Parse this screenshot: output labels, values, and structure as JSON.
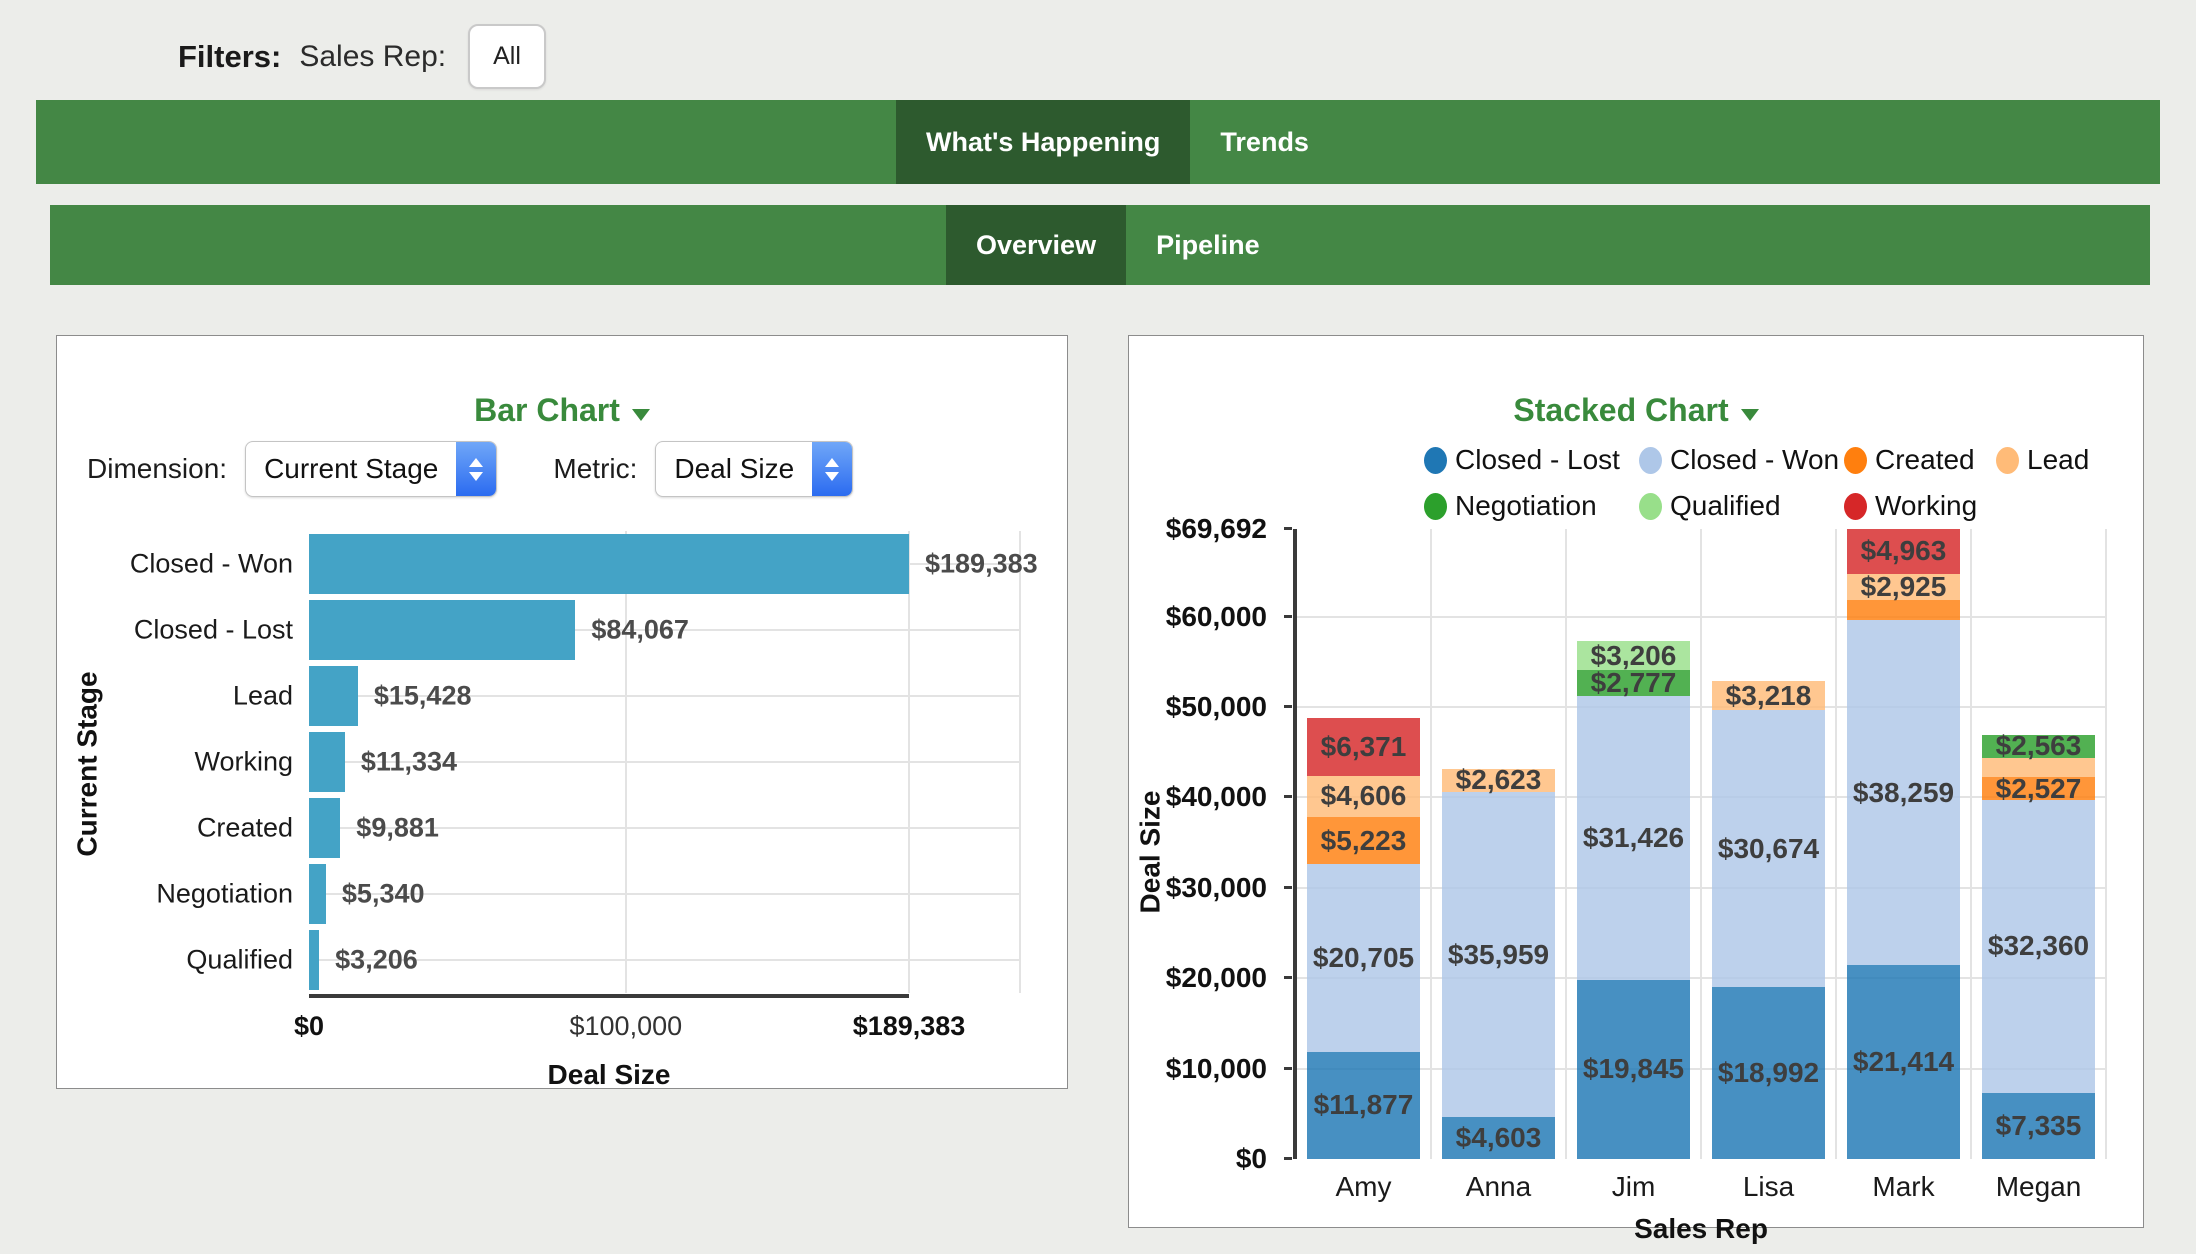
{
  "filters": {
    "label": "Filters:",
    "field_label": "Sales Rep:",
    "value": "All"
  },
  "nav_primary": {
    "tabs": [
      {
        "label": "What's Happening",
        "active": true
      },
      {
        "label": "Trends",
        "active": false
      }
    ]
  },
  "nav_secondary": {
    "tabs": [
      {
        "label": "Overview",
        "active": true
      },
      {
        "label": "Pipeline",
        "active": false
      }
    ]
  },
  "colors": {
    "nav_bar": "#448745",
    "nav_active": "#2d5a2e",
    "panel_title": "#398a3c",
    "left_bar": "#44a3c6",
    "grid": "#e3e3e3",
    "axis": "#3a3a3a",
    "page_bg": "#ecedea"
  },
  "left_panel": {
    "title": "Bar Chart",
    "dimension_label": "Dimension:",
    "dimension_value": "Current Stage",
    "metric_label": "Metric:",
    "metric_value": "Deal Size",
    "chart_data": {
      "type": "bar",
      "orientation": "horizontal",
      "categories": [
        "Closed - Won",
        "Closed - Lost",
        "Lead",
        "Working",
        "Created",
        "Negotiation",
        "Qualified"
      ],
      "values": [
        189383,
        84067,
        15428,
        11334,
        9881,
        5340,
        3206
      ],
      "value_labels": [
        "$189,383",
        "$84,067",
        "$15,428",
        "$11,334",
        "$9,881",
        "$5,340",
        "$3,206"
      ],
      "xlabel": "Deal Size",
      "ylabel": "Current Stage",
      "xlim": [
        0,
        189383
      ],
      "xticks": [
        {
          "label": "$0",
          "value": 0,
          "bold": true
        },
        {
          "label": "$100,000",
          "value": 100000,
          "bold": false
        },
        {
          "label": "$189,383",
          "value": 189383,
          "bold": true
        }
      ],
      "bar_color": "#44a3c6",
      "grid": true
    }
  },
  "right_panel": {
    "title": "Stacked Chart",
    "chart_data": {
      "type": "bar",
      "stacked": true,
      "categories": [
        "Amy",
        "Anna",
        "Jim",
        "Lisa",
        "Mark",
        "Megan"
      ],
      "series": [
        {
          "name": "Closed - Lost",
          "color": "#1f77b4",
          "values": [
            11877,
            4603,
            19845,
            18992,
            21414,
            7335
          ],
          "labels": [
            "$11,877",
            "$4,603",
            "$19,845",
            "$18,992",
            "$21,414",
            "$7,335"
          ]
        },
        {
          "name": "Closed - Won",
          "color": "#aec7e8",
          "values": [
            20705,
            35959,
            31426,
            30674,
            38259,
            32360
          ],
          "labels": [
            "$20,705",
            "$35,959",
            "$31,426",
            "$30,674",
            "$38,259",
            "$32,360"
          ]
        },
        {
          "name": "Created",
          "color": "#ff7f0e",
          "values": [
            5223,
            0,
            0,
            0,
            2131,
            2527
          ],
          "labels": [
            "$5,223",
            null,
            null,
            null,
            null,
            "$2,527"
          ]
        },
        {
          "name": "Lead",
          "color": "#ffbb78",
          "values": [
            4606,
            2623,
            0,
            3218,
            2925,
            2173
          ],
          "labels": [
            "$4,606",
            "$2,623",
            null,
            "$3,218",
            "$2,925",
            null
          ]
        },
        {
          "name": "Negotiation",
          "color": "#2ca02c",
          "values": [
            0,
            0,
            2777,
            0,
            0,
            2563
          ],
          "labels": [
            null,
            null,
            "$2,777",
            null,
            null,
            "$2,563"
          ]
        },
        {
          "name": "Qualified",
          "color": "#98df8a",
          "values": [
            0,
            0,
            3206,
            0,
            0,
            0
          ],
          "labels": [
            null,
            null,
            "$3,206",
            null,
            null,
            null
          ]
        },
        {
          "name": "Working",
          "color": "#d62728",
          "values": [
            6371,
            0,
            0,
            0,
            4963,
            0
          ],
          "labels": [
            "$6,371",
            null,
            null,
            null,
            "$4,963",
            null
          ]
        }
      ],
      "xlabel": "Sales Rep",
      "ylabel": "Deal Size",
      "ylim": [
        0,
        69692
      ],
      "yticks": [
        {
          "label": "$0",
          "value": 0
        },
        {
          "label": "$10,000",
          "value": 10000
        },
        {
          "label": "$20,000",
          "value": 20000
        },
        {
          "label": "$30,000",
          "value": 30000
        },
        {
          "label": "$40,000",
          "value": 40000
        },
        {
          "label": "$50,000",
          "value": 50000
        },
        {
          "label": "$60,000",
          "value": 60000
        },
        {
          "label": "$69,692",
          "value": 69692
        }
      ],
      "grid": true,
      "legend_position": "top",
      "segment_opacity": 0.82
    }
  }
}
